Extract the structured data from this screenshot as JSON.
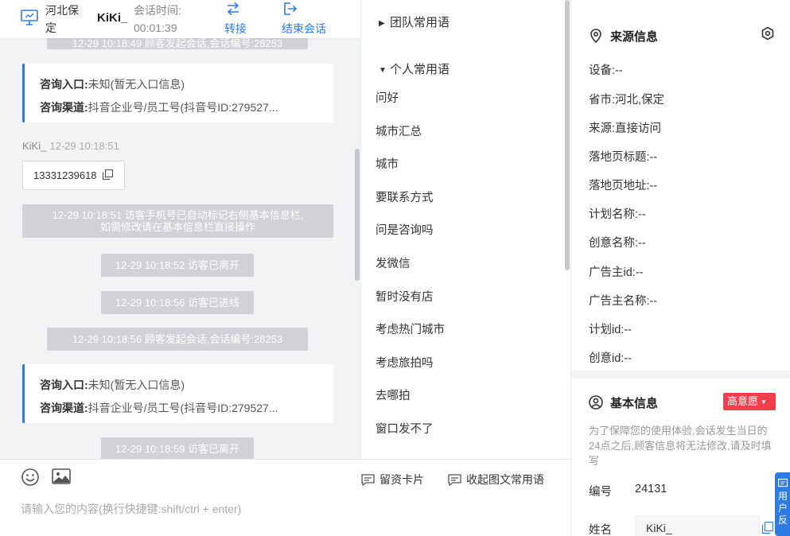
{
  "header": {
    "location": "河北保定",
    "visitor_name": "KiKi_",
    "session_label": "会话时间:",
    "session_time": "00:01:39",
    "transfer_label": "转接",
    "end_session_label": "结束会话"
  },
  "chat": {
    "top_partial_message": "12-29 10:18:49 顾客发起会话,会话编号:28253",
    "info_cards": [
      {
        "entry_label": "咨询入口:",
        "entry_value": "未知(暂无入口信息)",
        "channel_label": "咨询渠道:",
        "channel_value": "抖音企业号/员工号(抖音号ID:279527..."
      },
      {
        "entry_label": "咨询入口:",
        "entry_value": "未知(暂无入口信息)",
        "channel_label": "咨询渠道:",
        "channel_value": "抖音企业号/员工号(抖音号ID:279527..."
      }
    ],
    "sender_name": "KiKi_",
    "sender_time": "12-29 10:18:51",
    "phone_bubble": "13331239618",
    "system_messages": [
      "12-29 10:18:51 访客手机号已自动标记右侧基本信息栏,",
      "如需修改请在基本信息栏直接操作",
      "12-29 10:18:52 访客已离开",
      "12-29 10:18:56 访客已进线",
      "12-29 10:18:56 顾客发起会话,会话编号:28253",
      "12-29 10:18:59 访客已离开"
    ]
  },
  "input_area": {
    "placeholder": "请输入您的内容(换行快捷键:shift/ctrl + enter)",
    "card_button_label": "留资卡片",
    "collect_phrase_label": "收起图文常用语",
    "emoji_icon": "smile-icon",
    "image_icon": "image-icon"
  },
  "phrases": {
    "team_group_label": "团队常用语",
    "personal_group_label": "个人常用语",
    "items": [
      "问好",
      "城市汇总",
      "城市",
      "要联系方式",
      "问是咨询吗",
      "发微信",
      "暂时没有店",
      "考虑热门城市",
      "考虑旅拍吗",
      "去哪拍",
      "窗口发不了"
    ]
  },
  "source_info": {
    "title": "来源信息",
    "rows": [
      "设备:--",
      "省市:河北,保定",
      "来源:直接访问",
      "落地页标题:--",
      "落地页地址:--",
      "计划名称:--",
      "创意名称:--",
      "广告主id:--",
      "广告主名称:--",
      "计划id:--",
      "创意id:--"
    ]
  },
  "basic_info": {
    "title": "基本信息",
    "intent_badge": "高意愿",
    "note": "为了保障您的使用体验,会话发生当日的24点之后,顾客信息将无法修改,请及时填写",
    "id_label": "编号",
    "id_value": "24131",
    "name_label": "姓名",
    "name_value": "KiKi_"
  },
  "feedback_tab": {
    "chars": [
      "用",
      "户",
      "反"
    ]
  },
  "colors": {
    "accent": "#2e7be5",
    "badge_red": "#f1404b",
    "system_msg_bg": "#d0d2d5",
    "chat_bg": "#f2f3f5"
  }
}
